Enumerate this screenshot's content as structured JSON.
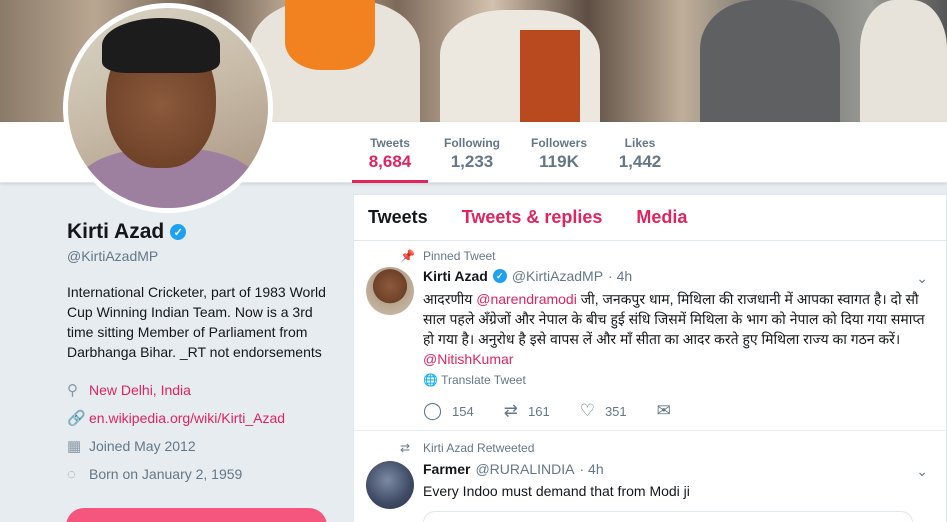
{
  "stats": [
    {
      "label": "Tweets",
      "value": "8,684"
    },
    {
      "label": "Following",
      "value": "1,233"
    },
    {
      "label": "Followers",
      "value": "119K"
    },
    {
      "label": "Likes",
      "value": "1,442"
    }
  ],
  "profile": {
    "name": "Kirti Azad",
    "handle": "@KirtiAzadMP",
    "bio": "International Cricketer, part of 1983 World Cup Winning Indian Team. Now is a 3rd time sitting Member of Parliament from Darbhanga Bihar. _RT not endorsements",
    "location": "New Delhi, India",
    "website": "en.wikipedia.org/wiki/Kirti_Azad",
    "joined": "Joined May 2012",
    "born": "Born on January 2, 1959"
  },
  "tabs": {
    "tweets": "Tweets",
    "replies": "Tweets & replies",
    "media": "Media"
  },
  "tweets": [
    {
      "context": "Pinned Tweet",
      "name": "Kirti Azad",
      "handle": "@KirtiAzadMP",
      "time": "· 4h",
      "text_1": "आदरणीय ",
      "mention_1": "@narendramodi",
      "text_2": " जी, जनकपुर धाम, मिथिला की राजधानी में आपका स्वागत है। दो सौ साल पहले अँग्रेजों और नेपाल के बीच हुई संधि जिसमें मिथिला के भाग को नेपाल को दिया गया समाप्त हो गया है। अनुरोध है इसे वापस लें और माँ सीता का आदर करते हुए मिथिला राज्य का गठन करें। ",
      "mention_2": "@NitishKumar",
      "translate": "Translate Tweet",
      "replies": "154",
      "retweets": "161",
      "likes": "351"
    },
    {
      "context": "Kirti Azad Retweeted",
      "name": "Farmer",
      "handle": "@RURALINDIA",
      "time": "· 4h",
      "text": "Every Indoo must demand that from Modi ji"
    }
  ],
  "colors": {
    "accent": "#e0245e",
    "verified": "#1da1f2"
  }
}
